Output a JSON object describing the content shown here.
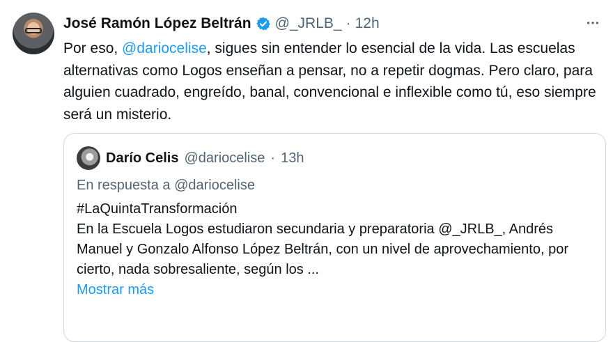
{
  "tweet": {
    "author_name": "José Ramón López Beltrán",
    "handle": "@_JRLB_",
    "separator": "·",
    "time": "12h",
    "verified_icon": "verified-badge-icon",
    "more_icon": "more-options-icon",
    "text": {
      "prefix": "Por eso, ",
      "mention": "@dariocelise",
      "rest": ", sigues sin entender lo esencial de la vida. Las escuelas alternativas como Logos enseñan a pensar, no a repetir dogmas. Pero claro, para alguien cuadrado, engreído, banal, convencional e inflexible como tú, eso siempre será un misterio."
    }
  },
  "quote": {
    "author_name": "Darío Celis",
    "handle": "@dariocelise",
    "separator": "·",
    "time": "13h",
    "reply_prefix": "En respuesta a ",
    "reply_handle": "@dariocelise",
    "hashtag": "#LaQuintaTransformación",
    "body": "En la Escuela Logos estudiaron secundaria y preparatoria @_JRLB_, Andrés Manuel y Gonzalo Alfonso López Beltrán, con un nivel de aprovechamiento, por cierto, nada sobresaliente, según los ...",
    "show_more": "Mostrar más"
  },
  "colors": {
    "text": "#0f1419",
    "muted": "#536471",
    "link": "#1d9bf0",
    "border": "#cfd9de"
  }
}
